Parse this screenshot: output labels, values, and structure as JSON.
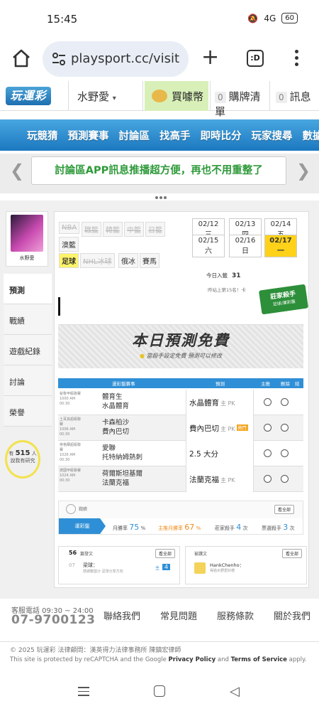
{
  "status": {
    "time": "15:45",
    "signal": "4G",
    "battery": "60"
  },
  "browser": {
    "url": "playsport.cc/visit",
    "tabs_label": ":D"
  },
  "header": {
    "logo": "玩運彩",
    "username": "水野愛",
    "coin_label": "買噱幣",
    "cart": {
      "count": "0",
      "label": "購牌清單"
    },
    "messages": {
      "count": "0",
      "label": "訊息"
    }
  },
  "nav": [
    "玩競猜",
    "預測賽事",
    "討論區",
    "找高手",
    "即時比分",
    "玩家搜尋",
    "數據"
  ],
  "banner": {
    "text": "討論區APP訊息推播超方便，再也不用重整了"
  },
  "sidebar": {
    "avatar_name": "水野愛",
    "tabs": [
      "預測",
      "戰績",
      "遊戲紀錄",
      "討論",
      "榮譽"
    ],
    "bulb": {
      "prefix": "有",
      "count": "515",
      "suffix": "人",
      "line2": "說我有研究"
    }
  },
  "leagues": {
    "row1": [
      "NBA",
      "職籃",
      "韓籃",
      "中籃",
      "日籃"
    ],
    "row2": [
      "澳籃"
    ],
    "row3": [
      "足球",
      "NHL冰球",
      "俄冰",
      "賽馬"
    ]
  },
  "dates": [
    "02/12 三",
    "02/13 四",
    "02/14 五",
    "02/15 六",
    "02/16 日",
    "02/17 一"
  ],
  "today": {
    "label": "今日入籤",
    "value": "31",
    "rank_line": "昨站上第15名！卡"
  },
  "master_badge": {
    "line1": "莊家殺手",
    "line2": "足球/運彩盤"
  },
  "free": {
    "title": "本日預測免費",
    "subtitle": "當殺手設定免費  預測可以修改"
  },
  "table": {
    "headers": {
      "match": "運彩盤賽事",
      "pred": "預測",
      "home": "主推",
      "delete": "刪除",
      "result": "結果"
    },
    "rows": [
      {
        "league": "秘魯甲級聯賽",
        "time": "1000 AM 00:30",
        "team1": "體育生",
        "team2": "水晶體育",
        "pick": "水晶體育",
        "pick_sub": "主 PK",
        "tag": ""
      },
      {
        "league": "土耳其超級聯賽",
        "time": "1006 AM 00:30",
        "team1": "卡森柏沙",
        "team2": "費內巴切",
        "pick": "費內巴切",
        "pick_sub": "主 PK",
        "tag": "熱門"
      },
      {
        "league": "英格蘭超級聯賽",
        "time": "1026 AM 00:30",
        "team1": "愛聯",
        "team2": "托特納姆熱刺",
        "pick": "2.5 大分",
        "pick_sub": "",
        "tag": ""
      },
      {
        "league": "德國甲級聯賽",
        "time": "1024 AM 00:30",
        "team1": "荷爾斯坦基爾",
        "team2": "法蘭克福",
        "pick": "法蘭克福",
        "pick_sub": "主 PK",
        "tag": ""
      }
    ]
  },
  "stats": {
    "label": "戰績",
    "more": "看全部",
    "first": "運彩盤",
    "month": {
      "label": "月勝率",
      "value": "75",
      "unit": "%"
    },
    "home_month": {
      "label": "主推月勝率",
      "value": "67",
      "unit": "%"
    },
    "killer": {
      "label": "莊家殺手",
      "value": "4",
      "unit": "次"
    },
    "hot": {
      "label": "票選殺手",
      "value": "3",
      "unit": "次"
    }
  },
  "cards": {
    "left": {
      "count": "56",
      "label": "篇發文",
      "more": "看全部",
      "day": "07",
      "title": "梁球：",
      "snippet": "感謝聯盟沙 足球分享方向",
      "reply_label": "主",
      "reply_count": "4"
    },
    "right": {
      "label": "被讚文",
      "more": "看全部",
      "user": "HankChenho：",
      "snippet": "得過水野愛好德"
    }
  },
  "footer": {
    "service_label": "客服電話 09:30 ~ 24:00",
    "phone": "07-9700123",
    "links": [
      "聯絡我們",
      "常見問題",
      "服務條款",
      "關於我們"
    ],
    "copyright": "© 2025 玩運彩  法律顧問：漢英得力法律事務所 陳鎮宏律師",
    "recaptcha_pre": "This site is protected by reCAPTCHA and the Google",
    "privacy": "Privacy Policy",
    "and": "and",
    "terms": "Terms of Service",
    "apply": "apply."
  }
}
